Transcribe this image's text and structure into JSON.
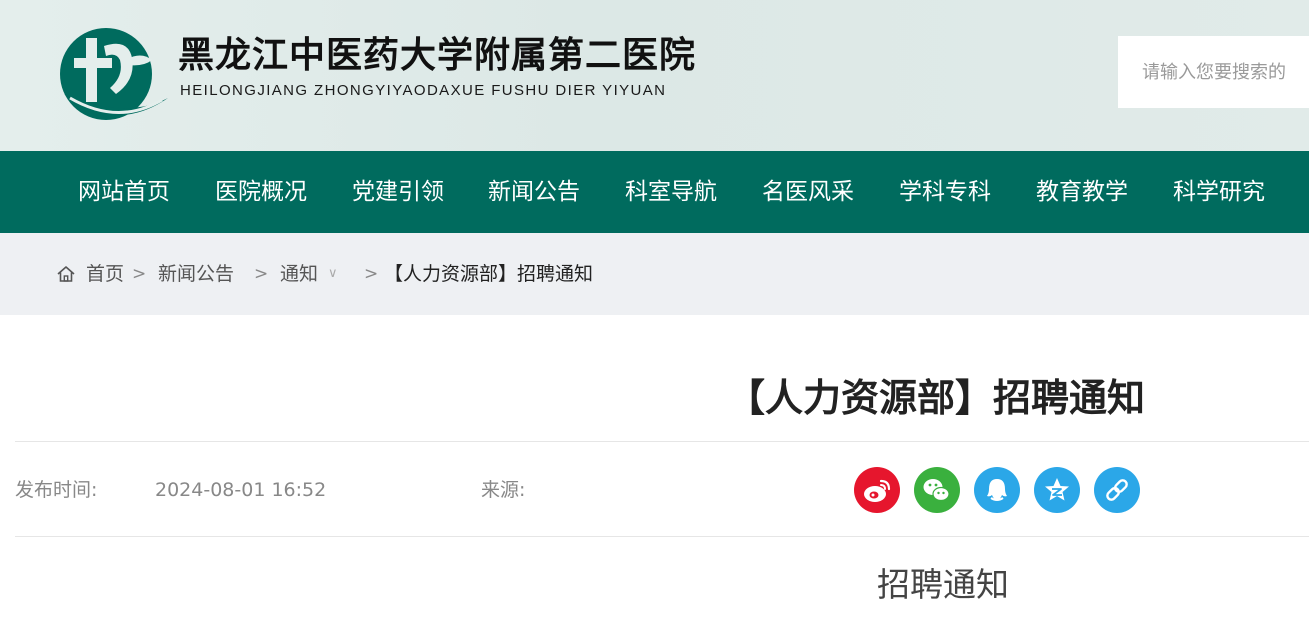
{
  "header": {
    "site_title": "黑龙江中医药大学附属第二医院",
    "site_subtitle": "HEILONGJIANG ZHONGYIYAODAXUE FUSHU DIER YIYUAN",
    "search_placeholder": "请输入您要搜索的",
    "logo_icon": "hospital-logo-icon"
  },
  "nav": {
    "items": [
      {
        "label": "网站首页"
      },
      {
        "label": "医院概况"
      },
      {
        "label": "党建引领"
      },
      {
        "label": "新闻公告"
      },
      {
        "label": "科室导航"
      },
      {
        "label": "名医风采"
      },
      {
        "label": "学科专科"
      },
      {
        "label": "教育教学"
      },
      {
        "label": "科学研究"
      }
    ]
  },
  "breadcrumb": {
    "home": "首页",
    "news": "新闻公告",
    "notice": "通知",
    "dropdown_glyph": "∨",
    "separator": ">",
    "current": "【人力资源部】招聘通知"
  },
  "article": {
    "title": "【人力资源部】招聘通知",
    "publish_label": "发布时间:",
    "publish_time": "2024-08-01 16:52",
    "source_label": "来源:",
    "subtitle": "招聘通知"
  },
  "share": [
    {
      "name": "weibo-icon",
      "color": "#e6162d"
    },
    {
      "name": "wechat-icon",
      "color": "#3ab03e"
    },
    {
      "name": "qq-icon",
      "color": "#2ba7e8"
    },
    {
      "name": "qzone-icon",
      "color": "#2ba7e8"
    },
    {
      "name": "copy-link-icon",
      "color": "#2ba7e8"
    }
  ],
  "colors": {
    "brand_green": "#006b5e",
    "breadcrumb_bg": "#eef0f3"
  }
}
